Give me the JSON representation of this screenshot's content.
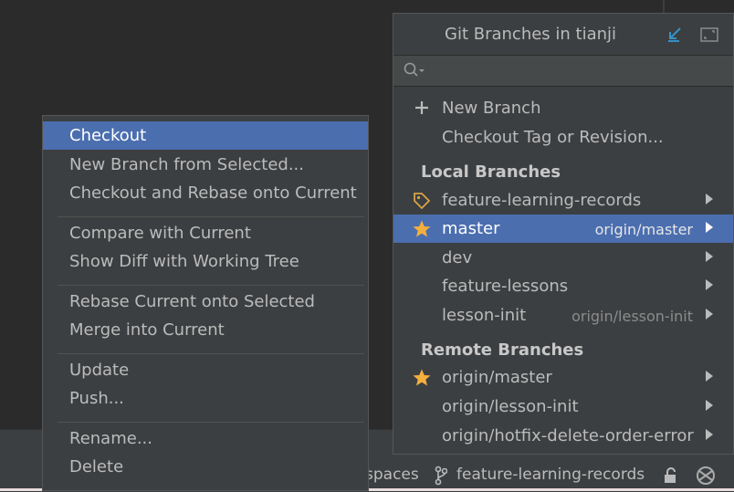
{
  "popup": {
    "title": "Git Branches in tianji",
    "actions": {
      "new_branch": "New Branch",
      "checkout_tag": "Checkout Tag or Revision..."
    },
    "local_header": "Local Branches",
    "local": [
      {
        "name": "feature-learning-records",
        "tracking": "",
        "icon": "tag-icon",
        "selected": false
      },
      {
        "name": "master",
        "tracking": "origin/master",
        "icon": "star-icon",
        "selected": true
      },
      {
        "name": "dev",
        "tracking": "",
        "icon": "",
        "selected": false
      },
      {
        "name": "feature-lessons",
        "tracking": "",
        "icon": "",
        "selected": false
      },
      {
        "name": "lesson-init",
        "tracking": "origin/lesson-init",
        "icon": "",
        "selected": false
      }
    ],
    "remote_header": "Remote Branches",
    "remote": [
      {
        "name": "origin/master",
        "icon": "star-icon"
      },
      {
        "name": "origin/lesson-init",
        "icon": ""
      },
      {
        "name": "origin/hotfix-delete-order-error",
        "icon": ""
      }
    ]
  },
  "context_menu": {
    "items": [
      "Checkout",
      "New Branch from Selected...",
      "Checkout and Rebase onto Current",
      "Compare with Current",
      "Show Diff with Working Tree",
      "Rebase Current onto Selected",
      "Merge into Current",
      "Update",
      "Push...",
      "Rename...",
      "Delete"
    ],
    "selected_index": 0
  },
  "statusbar": {
    "indent_text": "spaces",
    "branch": "feature-learning-records"
  },
  "colors": {
    "selection": "#4b6eaf",
    "star": "#f4af3d",
    "tag": "#d9a343",
    "accent": "#3592c4"
  }
}
